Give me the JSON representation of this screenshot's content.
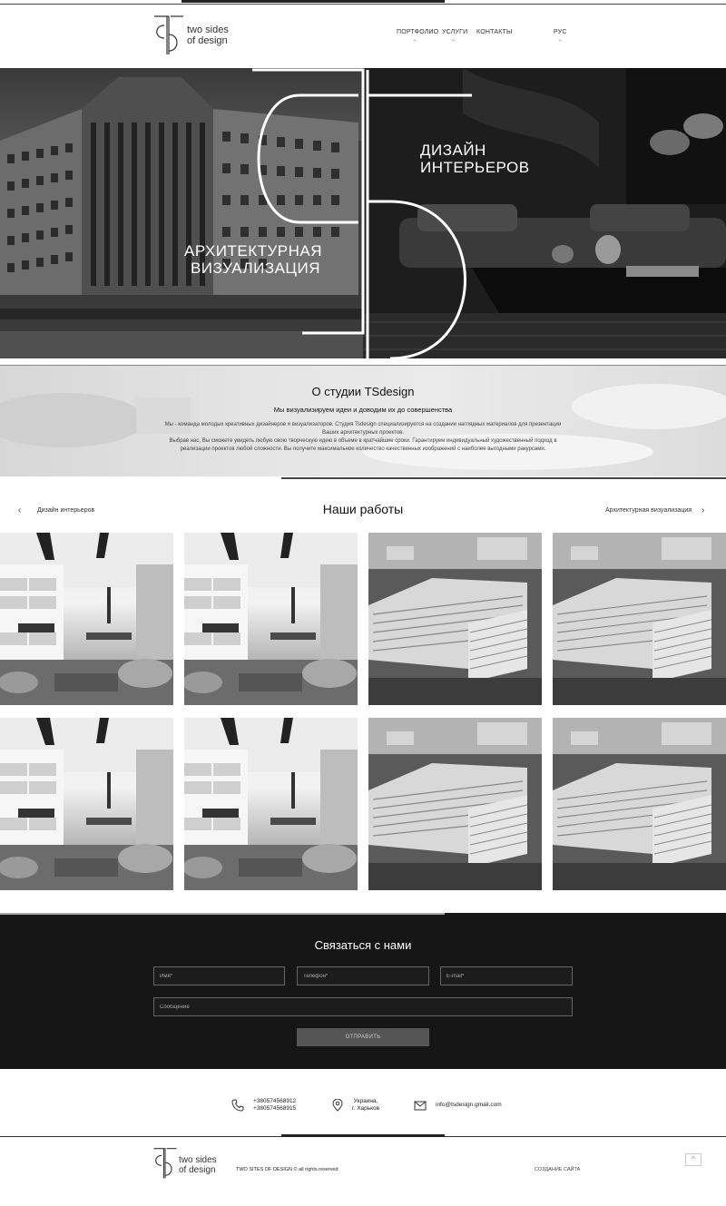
{
  "brand": {
    "line1": "two sides",
    "line2": "of design"
  },
  "nav": {
    "portfolio": "ПОРТФОЛИО",
    "services": "УСЛУГИ",
    "contacts": "КОНТАКТЫ",
    "lang": "РУС"
  },
  "hero": {
    "arch_line1": "АРХИТЕКТУРНАЯ",
    "arch_line2": "ВИЗУАЛИЗАЦИЯ",
    "interior_line1": "ДИЗАЙН",
    "interior_line2": "ИНТЕРЬЕРОВ"
  },
  "about": {
    "title": "О студии TSdesign",
    "subtitle": "Мы визуализируем идеи и доводим их до совершенства",
    "desc1": "Мы - команда молодых креативных дизайнеров и визуализаторов. Студия Tsdesign специализируется на создании наглядных материалов для презентации Ваших архитектурных проектов.",
    "desc2": "Выбрав нас, Вы сможете увидеть любую свою творческую идею в объеме в кратчайшие сроки. Гарантируем индивидуальный художественный подход в реализации проектов любой сложности. Вы получите максимальное количество качественных изображений с наиболее выгодными ракурсами."
  },
  "works": {
    "title": "Наши работы",
    "left_link": "Дизайн интерьеров",
    "right_link": "Архитектурная визуализация",
    "arrow_left": "‹",
    "arrow_right": "›"
  },
  "contact": {
    "title": "Связаться с нами",
    "name_placeholder": "Имя*",
    "phone_placeholder": "Телефон*",
    "email_placeholder": "E-mail*",
    "message_placeholder": "Сообщение",
    "submit": "ОТПРАВИТЬ"
  },
  "info": {
    "phone1": "+380574568912",
    "phone2": "+380574568915",
    "country": "Украина,",
    "city": "г. Харьков",
    "email": "info@tsdesign.gmail.com"
  },
  "footer": {
    "brand_line1": "two sides",
    "brand_line2": "of design",
    "copyright": "TWO SITES OF DESIGN © all rights reserved",
    "made": "СОЗДАНИЕ САЙТА",
    "up": "^"
  }
}
